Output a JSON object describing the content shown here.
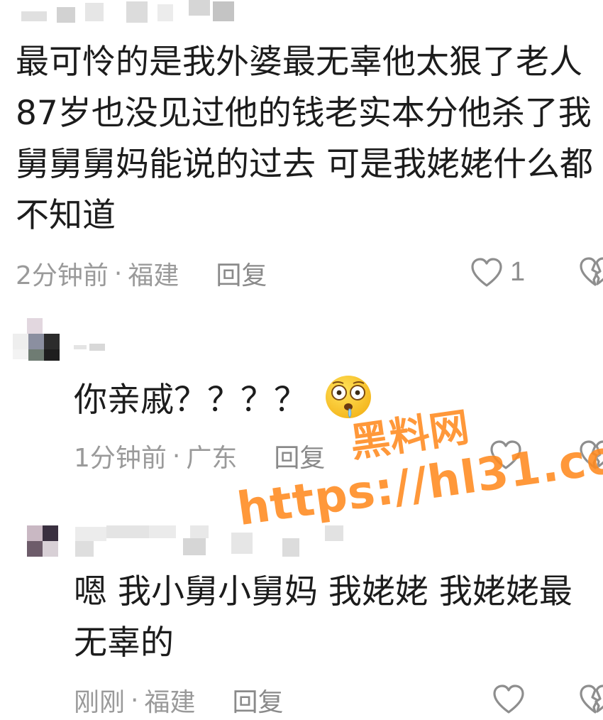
{
  "comments": [
    {
      "text": "最可怜的是我外婆最无辜他太狠了老人87岁也没见过他的钱老实本分他杀了我舅舅舅妈能说的过去 可是我姥姥什么都不知道",
      "time": "2分钟前",
      "location": "福建",
      "reply_label": "回复",
      "like_count": "1"
    },
    {
      "text": "你亲戚？？？？",
      "time": "1分钟前",
      "location": "广东",
      "reply_label": "回复",
      "emoji": "flushed-drooling-face"
    },
    {
      "text": "嗯 我小舅小舅妈 我姥姥 我姥姥最无辜的",
      "time": "刚刚",
      "location": "福建",
      "reply_label": "回复"
    }
  ],
  "meta_separator": "·",
  "watermark": {
    "line1": "黑料网",
    "line2": "https://hl31.co"
  },
  "colors": {
    "text": "#1c1c1c",
    "meta": "#9a9a9a",
    "icon": "#8e8e8e",
    "watermark": "#ff8a1f"
  }
}
